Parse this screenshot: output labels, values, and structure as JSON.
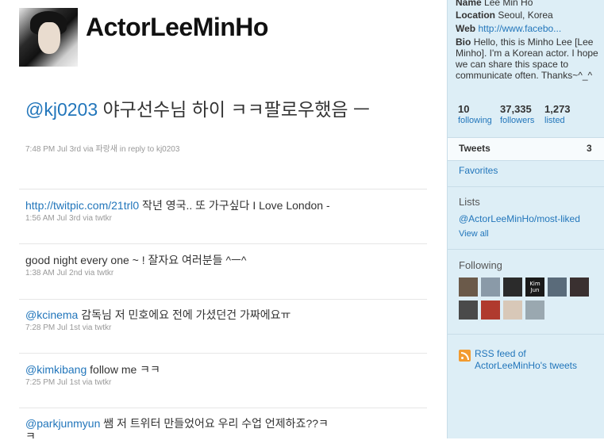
{
  "profile": {
    "screen_name": "ActorLeeMinHo",
    "name_label": "Name",
    "name": "Lee Min Ho",
    "location_label": "Location",
    "location": "Seoul, Korea",
    "web_label": "Web",
    "web": "http://www.facebo...",
    "bio_label": "Bio",
    "bio": "Hello, this is Minho Lee [Lee Minho]. I'm a Korean actor. I hope we can share this space to communicate often. Thanks~^_^"
  },
  "featured_tweet": {
    "mention": "@kj0203",
    "text": " 야구선수님 하이 ㅋㅋ팔로우했음 ㅡ",
    "time": "7:48 PM Jul 3rd",
    "via": "via",
    "client": "파랑새",
    "reply_prefix": "in reply to",
    "reply_to": "kj0203"
  },
  "tweets": [
    {
      "link": "http://twitpic.com/21trl0",
      "text": " 작년 영국.. 또 가구싶다 I Love London -",
      "time": "1:56 AM Jul 3rd",
      "via": "via",
      "client": "twtkr"
    },
    {
      "link": "",
      "text": "good night every one ~ ! 잘자요 여러분들 ^ㅡ^",
      "time": "1:38 AM Jul 2nd",
      "via": "via",
      "client": "twtkr"
    },
    {
      "link": "@kcinema",
      "text": " 감독님 저 민호에요 전에 가셨던건 가짜에요ㅠ",
      "time": "7:28 PM Jul 1st",
      "via": "via",
      "client": "twtkr"
    },
    {
      "link": "@kimkibang",
      "text": " follow me ㅋㅋ",
      "time": "7:25 PM Jul 1st",
      "via": "via",
      "client": "twtkr"
    },
    {
      "link": "@parkjunmyun",
      "text": " 쌤 저 트위터 만들었어요 우리 수업 언제하죠??ㅋ",
      "text2": "ㅋ",
      "time": "",
      "via": "",
      "client": ""
    }
  ],
  "stats": {
    "following_count": "10",
    "following_label": "following",
    "followers_count": "37,335",
    "followers_label": "followers",
    "listed_count": "1,273",
    "listed_label": "listed"
  },
  "sidebar": {
    "tweets_label": "Tweets",
    "tweets_count": "3",
    "favorites_label": "Favorites",
    "lists_heading": "Lists",
    "list_link": "@ActorLeeMinHo/most-liked",
    "view_all": "View all",
    "following_heading": "Following",
    "following_avatars": [
      {
        "name": "following-avatar-1",
        "color": "#6b5a4a"
      },
      {
        "name": "following-avatar-2",
        "color": "#8a9aa8"
      },
      {
        "name": "following-avatar-3",
        "color": "#2b2b2b"
      },
      {
        "name": "following-avatar-4",
        "color": "#1a1a1a",
        "caption": "Kim Jun"
      },
      {
        "name": "following-avatar-5",
        "color": "#5a6b7a"
      },
      {
        "name": "following-avatar-6",
        "color": "#3a3030"
      },
      {
        "name": "following-avatar-7",
        "color": "#4a4a4a"
      },
      {
        "name": "following-avatar-8",
        "color": "#b03a2e"
      },
      {
        "name": "following-avatar-9",
        "color": "#d8c8b8"
      },
      {
        "name": "following-avatar-10",
        "color": "#9aa8b0"
      }
    ],
    "rss_line1": "RSS feed of",
    "rss_line2": "ActorLeeMinHo's tweets"
  }
}
